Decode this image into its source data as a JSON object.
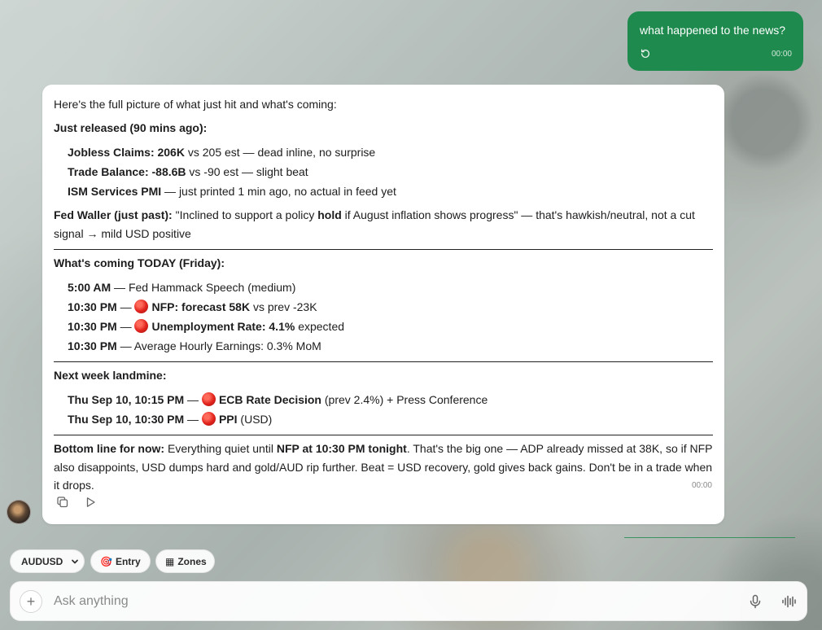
{
  "user_message": {
    "text": "what happened to the news?",
    "time": "00:00"
  },
  "assistant_message": {
    "intro": "Here's the full picture of what just hit and what's coming:",
    "just_released": {
      "heading": "Just released (90 mins ago):",
      "items": [
        {
          "bold": "Jobless Claims: 206K",
          "rest": " vs 205 est — dead inline, no surprise"
        },
        {
          "bold": "Trade Balance: -88.6B",
          "rest": " vs -90 est — slight beat"
        },
        {
          "bold": "ISM Services PMI",
          "rest": " — just printed 1 min ago, no actual in feed yet"
        }
      ]
    },
    "fed_waller": {
      "label": "Fed Waller (just past):",
      "quote_start": " \"Inclined to support a policy ",
      "quote_bold": "hold",
      "quote_end": " if August inflation shows progress\" — that's hawkish/neutral, not a cut signal → mild USD positive"
    },
    "today": {
      "heading": "What's coming TODAY (Friday):",
      "items": [
        {
          "time": "5:00 AM",
          "sep": " — ",
          "red": false,
          "bold": "",
          "rest": "Fed Hammack Speech (medium)"
        },
        {
          "time": "10:30 PM",
          "sep": " — ",
          "red": true,
          "bold": "NFP: forecast 58K",
          "rest": " vs prev -23K"
        },
        {
          "time": "10:30 PM",
          "sep": " — ",
          "red": true,
          "bold": "Unemployment Rate: 4.1%",
          "rest": " expected"
        },
        {
          "time": "10:30 PM",
          "sep": " — ",
          "red": false,
          "bold": "",
          "rest": "Average Hourly Earnings: 0.3% MoM"
        }
      ]
    },
    "next_week": {
      "heading": "Next week landmine:",
      "items": [
        {
          "time": "Thu Sep 10, 10:15 PM",
          "sep": " — ",
          "red": true,
          "bold": "ECB Rate Decision",
          "rest": " (prev 2.4%) + Press Conference"
        },
        {
          "time": "Thu Sep 10, 10:30 PM",
          "sep": " — ",
          "red": true,
          "bold": "PPI",
          "rest": " (USD)"
        }
      ]
    },
    "bottom_line": {
      "label": "Bottom line for now:",
      "part1": " Everything quiet until ",
      "bold2": "NFP at 10:30 PM tonight",
      "part2": ". That's the big one — ADP already missed at 38K, so if NFP also disappoints, USD dumps hard and gold/AUD rip further. Beat = USD recovery, gold gives back gains. Don't be in a trade when it drops."
    },
    "time": "00:00"
  },
  "chips": {
    "symbol": "AUDUSD",
    "entry_icon": "🎯",
    "entry": "Entry",
    "zones_icon": "▦",
    "zones": "Zones"
  },
  "composer": {
    "placeholder": "Ask anything",
    "plus": "+"
  },
  "colors": {
    "user_bubble": "#1e8a4e",
    "alert_dot": "#e0231c"
  }
}
